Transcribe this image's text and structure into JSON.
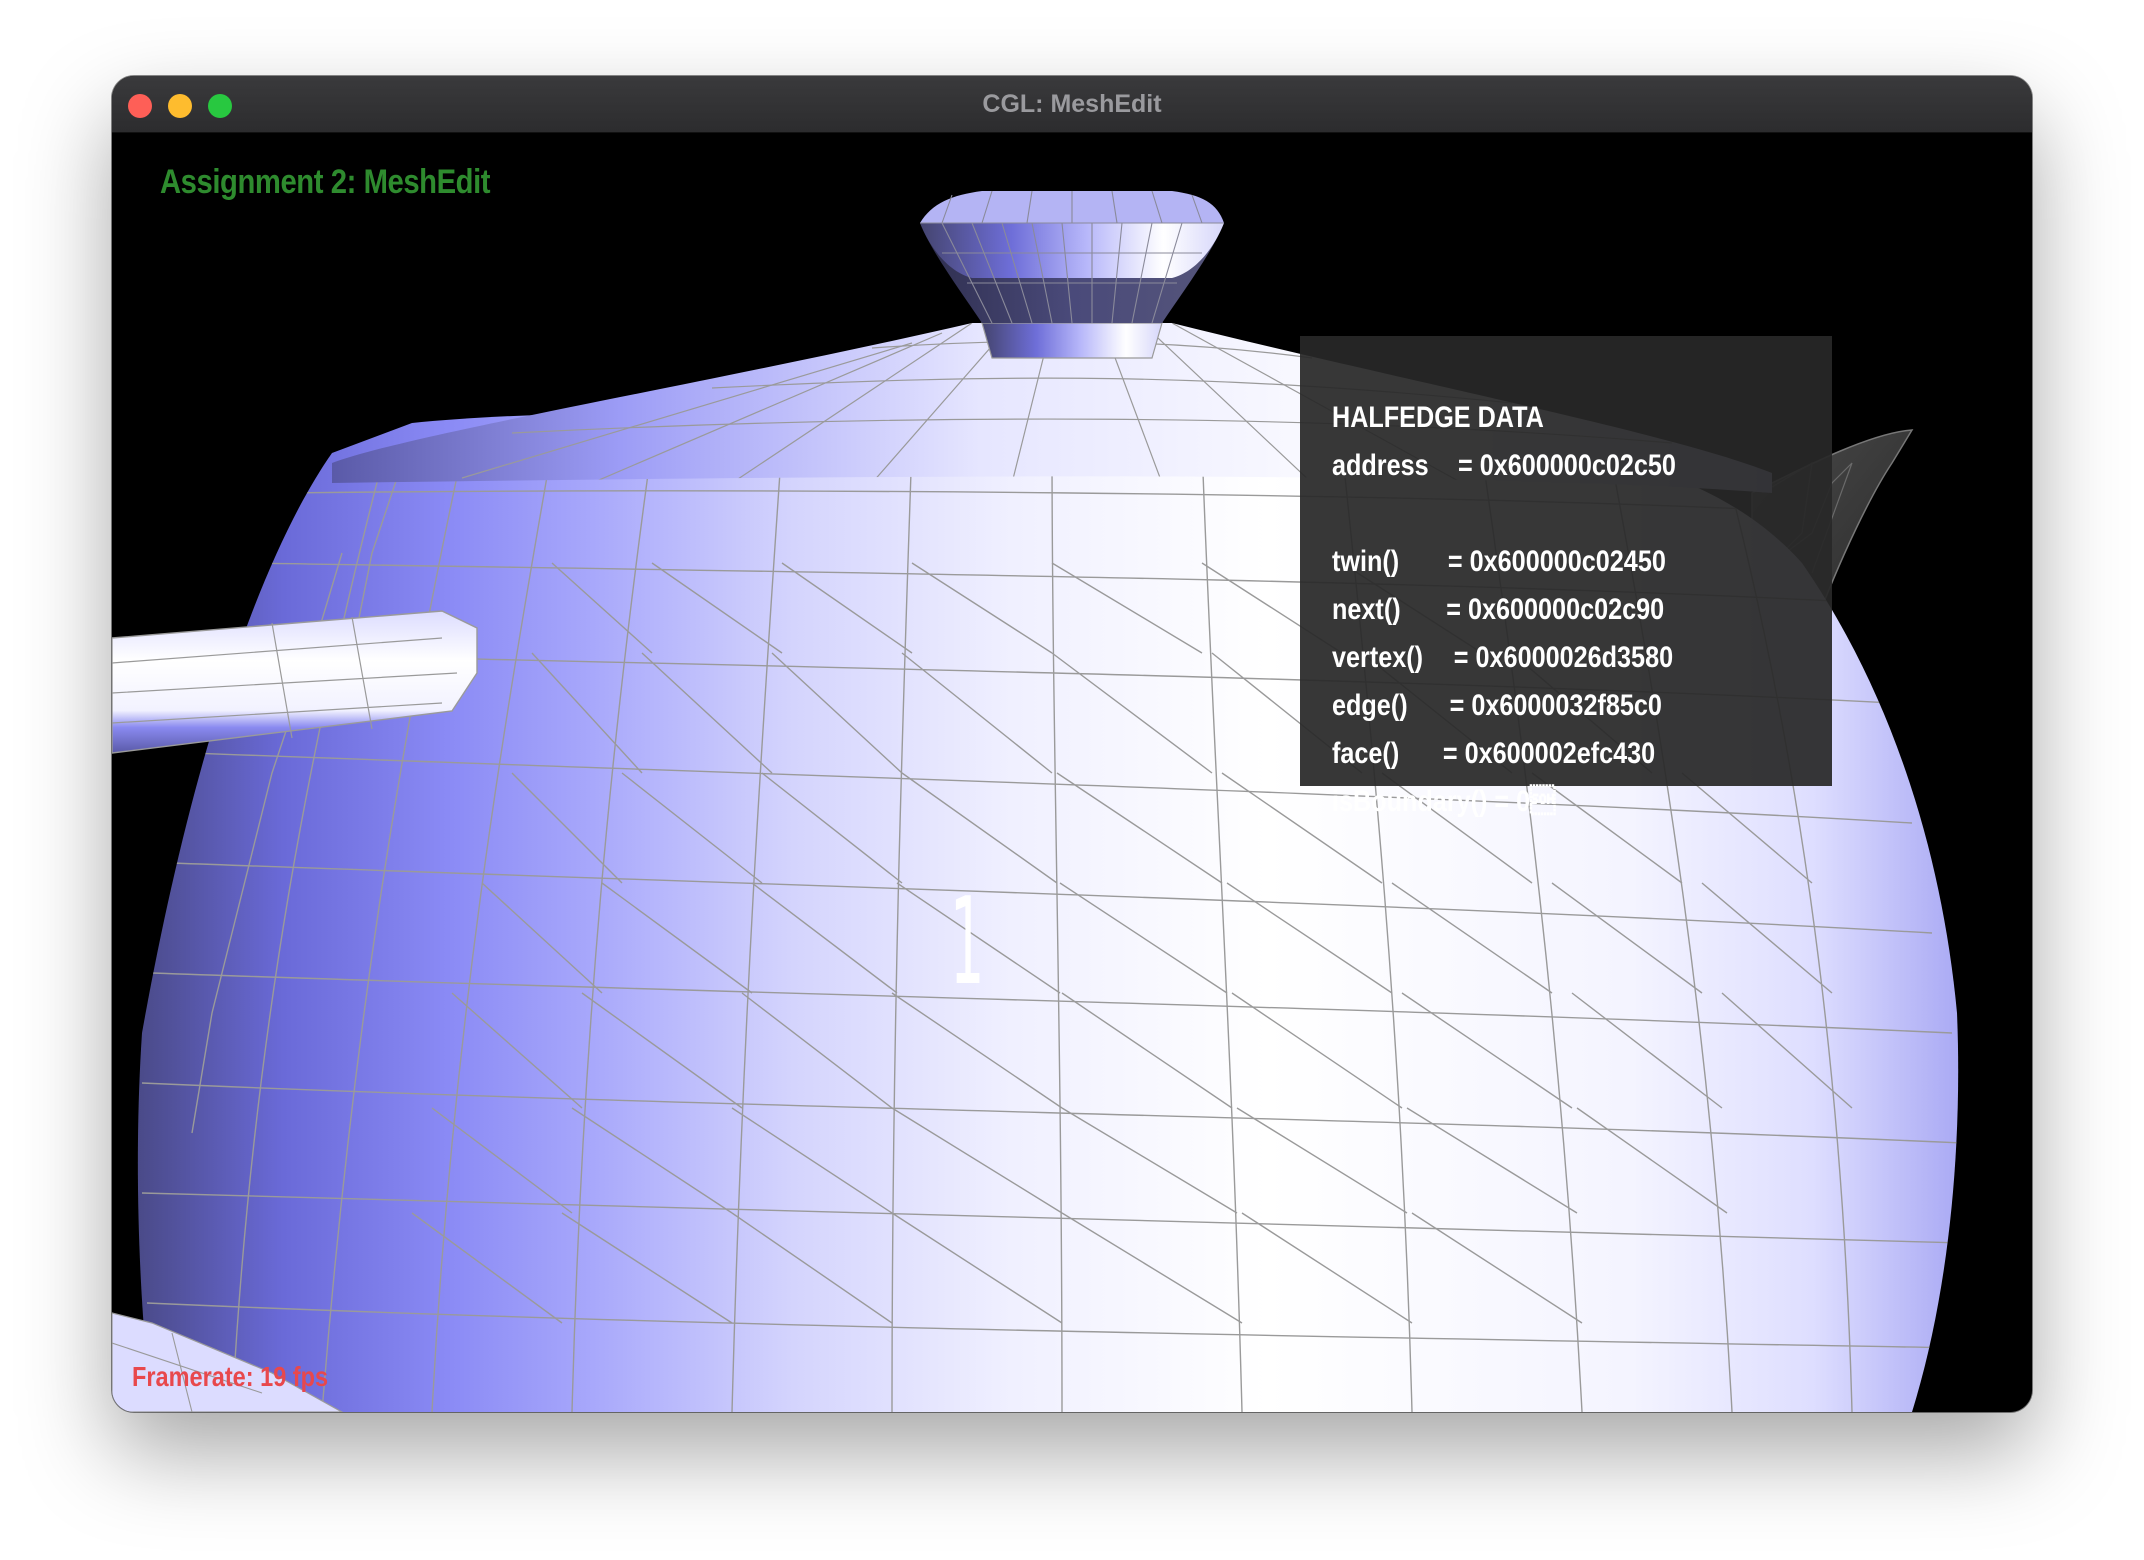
{
  "window": {
    "title": "CGL: MeshEdit"
  },
  "app": {
    "title": "Assignment 2: MeshEdit",
    "face_label": "1",
    "framerate": "Framerate: 19 fps"
  },
  "halfedge_panel": {
    "heading": "HALFEDGE DATA",
    "rows": [
      {
        "key": "address",
        "value": "= 0x600000c02c50"
      },
      {
        "key": "twin()",
        "value": "= 0x600000c02450"
      },
      {
        "key": "next()",
        "value": "= 0x600000c02c90"
      },
      {
        "key": "vertex()",
        "value": "= 0x6000026d3580"
      },
      {
        "key": "edge()",
        "value": "= 0x6000032f85c0"
      },
      {
        "key": "face()",
        "value": "= 0x600002efc430"
      },
      {
        "key": "isBoundary()",
        "value": "= 0\u0001"
      }
    ]
  },
  "colors": {
    "app_title": "#2e8b2e",
    "framerate": "#e8484c",
    "mesh_light": "#f2f2ff",
    "mesh_shadow": "#7878ee",
    "edges": "#9a9a9a"
  }
}
